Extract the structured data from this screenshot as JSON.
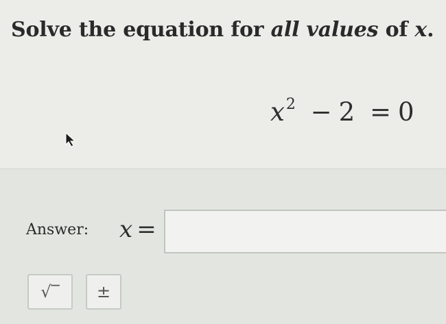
{
  "question": {
    "prompt_part1": "Solve the equation for ",
    "prompt_emphasis": "all values",
    "prompt_part2": " of ",
    "prompt_var": "x",
    "prompt_end": ".",
    "equation": {
      "variable": "x",
      "exponent": "2",
      "minus": "−",
      "constant": "2",
      "equals": "=",
      "rhs": "0"
    }
  },
  "answer": {
    "label": "Answer:",
    "variable": "x",
    "equals": "=",
    "input_value": ""
  },
  "toolbar": {
    "sqrt_label": "√‾",
    "plus_minus_label": "±"
  },
  "icons": {
    "cursor": "mouse-pointer-icon"
  }
}
